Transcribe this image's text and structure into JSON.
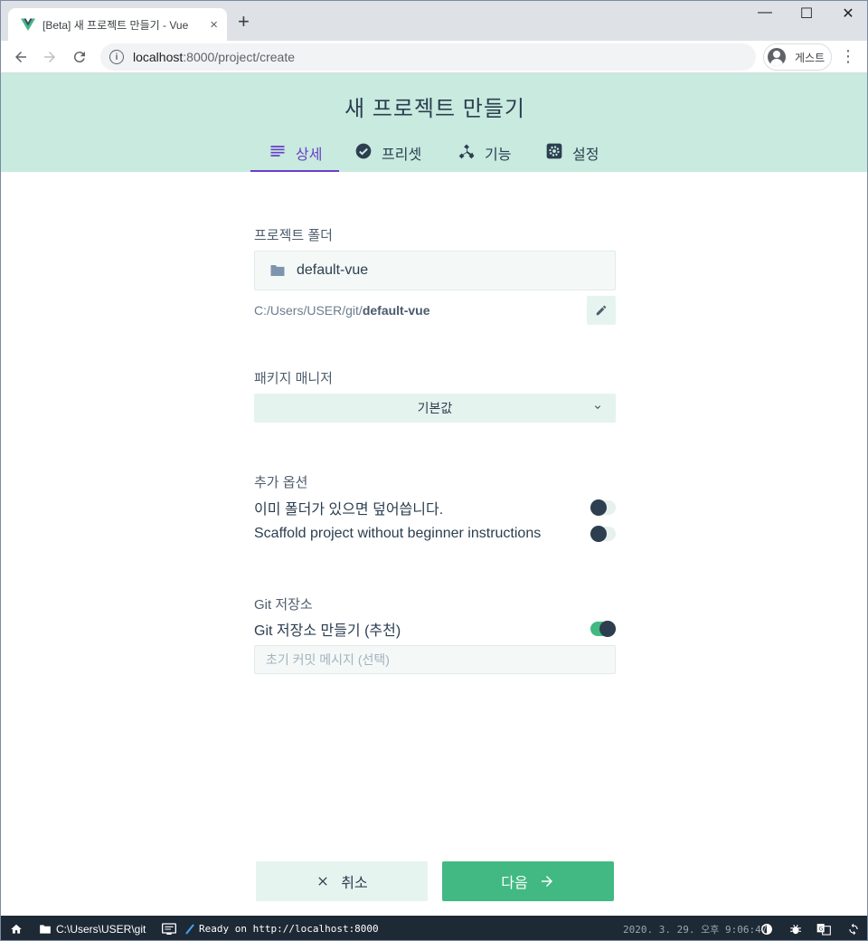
{
  "browser": {
    "tab_title": "[Beta] 새 프로젝트 만들기 - Vue",
    "tab_close": "×",
    "new_tab": "+",
    "window_controls": {
      "minimize": "—",
      "maximize": "☐",
      "close": "✕"
    },
    "url_host": "localhost",
    "url_rest": ":8000/project/create",
    "profile_label": "게스트",
    "menu_glyph": "⋮"
  },
  "header": {
    "title": "새 프로젝트 만들기",
    "tabs": [
      {
        "label": "상세",
        "icon": "subject-icon",
        "active": true
      },
      {
        "label": "프리셋",
        "icon": "check-circle-icon",
        "active": false
      },
      {
        "label": "기능",
        "icon": "device-hub-icon",
        "active": false
      },
      {
        "label": "설정",
        "icon": "settings-icon",
        "active": false
      }
    ]
  },
  "form": {
    "folder_section_title": "프로젝트 폴더",
    "folder_name": "default-vue",
    "path_prefix": "C:/Users/USER/git/",
    "path_folder": "default-vue",
    "package_manager_title": "패키지 매니저",
    "package_manager_value": "기본값",
    "extra_options_title": "추가 옵션",
    "options": [
      {
        "label": "이미 폴더가 있으면 덮어씁니다.",
        "checked": false
      },
      {
        "label": "Scaffold project without beginner instructions",
        "checked": false
      }
    ],
    "git_title": "Git 저장소",
    "git_option": {
      "label": "Git 저장소 만들기 (추천)",
      "checked": true
    },
    "commit_placeholder": "초기 커밋 메시지 (선택)"
  },
  "buttons": {
    "cancel": "취소",
    "next": "다음"
  },
  "statusbar": {
    "cwd": "C:\\Users\\USER\\git",
    "log": "Ready on http://localhost:8000",
    "datetime": "2020. 3. 29. 오후 9:06:47"
  },
  "colors": {
    "accent_green": "#42b983",
    "header_bg": "#c8eadf",
    "active_tab": "#6a3fc8",
    "statusbar_bg": "#1d2935"
  }
}
